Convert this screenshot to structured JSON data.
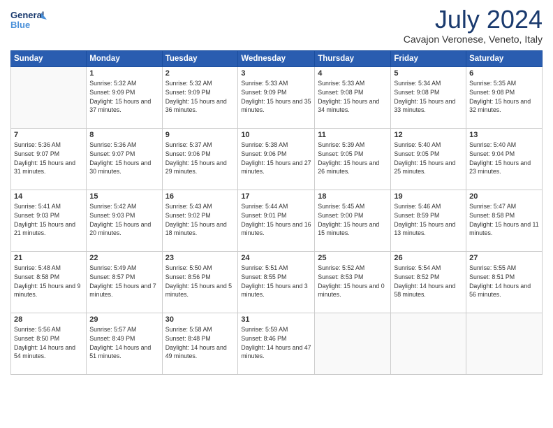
{
  "logo": {
    "line1": "General",
    "line2": "Blue"
  },
  "title": "July 2024",
  "location": "Cavajon Veronese, Veneto, Italy",
  "weekdays": [
    "Sunday",
    "Monday",
    "Tuesday",
    "Wednesday",
    "Thursday",
    "Friday",
    "Saturday"
  ],
  "weeks": [
    [
      {
        "day": "",
        "sunrise": "",
        "sunset": "",
        "daylight": ""
      },
      {
        "day": "1",
        "sunrise": "Sunrise: 5:32 AM",
        "sunset": "Sunset: 9:09 PM",
        "daylight": "Daylight: 15 hours and 37 minutes."
      },
      {
        "day": "2",
        "sunrise": "Sunrise: 5:32 AM",
        "sunset": "Sunset: 9:09 PM",
        "daylight": "Daylight: 15 hours and 36 minutes."
      },
      {
        "day": "3",
        "sunrise": "Sunrise: 5:33 AM",
        "sunset": "Sunset: 9:09 PM",
        "daylight": "Daylight: 15 hours and 35 minutes."
      },
      {
        "day": "4",
        "sunrise": "Sunrise: 5:33 AM",
        "sunset": "Sunset: 9:08 PM",
        "daylight": "Daylight: 15 hours and 34 minutes."
      },
      {
        "day": "5",
        "sunrise": "Sunrise: 5:34 AM",
        "sunset": "Sunset: 9:08 PM",
        "daylight": "Daylight: 15 hours and 33 minutes."
      },
      {
        "day": "6",
        "sunrise": "Sunrise: 5:35 AM",
        "sunset": "Sunset: 9:08 PM",
        "daylight": "Daylight: 15 hours and 32 minutes."
      }
    ],
    [
      {
        "day": "7",
        "sunrise": "Sunrise: 5:36 AM",
        "sunset": "Sunset: 9:07 PM",
        "daylight": "Daylight: 15 hours and 31 minutes."
      },
      {
        "day": "8",
        "sunrise": "Sunrise: 5:36 AM",
        "sunset": "Sunset: 9:07 PM",
        "daylight": "Daylight: 15 hours and 30 minutes."
      },
      {
        "day": "9",
        "sunrise": "Sunrise: 5:37 AM",
        "sunset": "Sunset: 9:06 PM",
        "daylight": "Daylight: 15 hours and 29 minutes."
      },
      {
        "day": "10",
        "sunrise": "Sunrise: 5:38 AM",
        "sunset": "Sunset: 9:06 PM",
        "daylight": "Daylight: 15 hours and 27 minutes."
      },
      {
        "day": "11",
        "sunrise": "Sunrise: 5:39 AM",
        "sunset": "Sunset: 9:05 PM",
        "daylight": "Daylight: 15 hours and 26 minutes."
      },
      {
        "day": "12",
        "sunrise": "Sunrise: 5:40 AM",
        "sunset": "Sunset: 9:05 PM",
        "daylight": "Daylight: 15 hours and 25 minutes."
      },
      {
        "day": "13",
        "sunrise": "Sunrise: 5:40 AM",
        "sunset": "Sunset: 9:04 PM",
        "daylight": "Daylight: 15 hours and 23 minutes."
      }
    ],
    [
      {
        "day": "14",
        "sunrise": "Sunrise: 5:41 AM",
        "sunset": "Sunset: 9:03 PM",
        "daylight": "Daylight: 15 hours and 21 minutes."
      },
      {
        "day": "15",
        "sunrise": "Sunrise: 5:42 AM",
        "sunset": "Sunset: 9:03 PM",
        "daylight": "Daylight: 15 hours and 20 minutes."
      },
      {
        "day": "16",
        "sunrise": "Sunrise: 5:43 AM",
        "sunset": "Sunset: 9:02 PM",
        "daylight": "Daylight: 15 hours and 18 minutes."
      },
      {
        "day": "17",
        "sunrise": "Sunrise: 5:44 AM",
        "sunset": "Sunset: 9:01 PM",
        "daylight": "Daylight: 15 hours and 16 minutes."
      },
      {
        "day": "18",
        "sunrise": "Sunrise: 5:45 AM",
        "sunset": "Sunset: 9:00 PM",
        "daylight": "Daylight: 15 hours and 15 minutes."
      },
      {
        "day": "19",
        "sunrise": "Sunrise: 5:46 AM",
        "sunset": "Sunset: 8:59 PM",
        "daylight": "Daylight: 15 hours and 13 minutes."
      },
      {
        "day": "20",
        "sunrise": "Sunrise: 5:47 AM",
        "sunset": "Sunset: 8:58 PM",
        "daylight": "Daylight: 15 hours and 11 minutes."
      }
    ],
    [
      {
        "day": "21",
        "sunrise": "Sunrise: 5:48 AM",
        "sunset": "Sunset: 8:58 PM",
        "daylight": "Daylight: 15 hours and 9 minutes."
      },
      {
        "day": "22",
        "sunrise": "Sunrise: 5:49 AM",
        "sunset": "Sunset: 8:57 PM",
        "daylight": "Daylight: 15 hours and 7 minutes."
      },
      {
        "day": "23",
        "sunrise": "Sunrise: 5:50 AM",
        "sunset": "Sunset: 8:56 PM",
        "daylight": "Daylight: 15 hours and 5 minutes."
      },
      {
        "day": "24",
        "sunrise": "Sunrise: 5:51 AM",
        "sunset": "Sunset: 8:55 PM",
        "daylight": "Daylight: 15 hours and 3 minutes."
      },
      {
        "day": "25",
        "sunrise": "Sunrise: 5:52 AM",
        "sunset": "Sunset: 8:53 PM",
        "daylight": "Daylight: 15 hours and 0 minutes."
      },
      {
        "day": "26",
        "sunrise": "Sunrise: 5:54 AM",
        "sunset": "Sunset: 8:52 PM",
        "daylight": "Daylight: 14 hours and 58 minutes."
      },
      {
        "day": "27",
        "sunrise": "Sunrise: 5:55 AM",
        "sunset": "Sunset: 8:51 PM",
        "daylight": "Daylight: 14 hours and 56 minutes."
      }
    ],
    [
      {
        "day": "28",
        "sunrise": "Sunrise: 5:56 AM",
        "sunset": "Sunset: 8:50 PM",
        "daylight": "Daylight: 14 hours and 54 minutes."
      },
      {
        "day": "29",
        "sunrise": "Sunrise: 5:57 AM",
        "sunset": "Sunset: 8:49 PM",
        "daylight": "Daylight: 14 hours and 51 minutes."
      },
      {
        "day": "30",
        "sunrise": "Sunrise: 5:58 AM",
        "sunset": "Sunset: 8:48 PM",
        "daylight": "Daylight: 14 hours and 49 minutes."
      },
      {
        "day": "31",
        "sunrise": "Sunrise: 5:59 AM",
        "sunset": "Sunset: 8:46 PM",
        "daylight": "Daylight: 14 hours and 47 minutes."
      },
      {
        "day": "",
        "sunrise": "",
        "sunset": "",
        "daylight": ""
      },
      {
        "day": "",
        "sunrise": "",
        "sunset": "",
        "daylight": ""
      },
      {
        "day": "",
        "sunrise": "",
        "sunset": "",
        "daylight": ""
      }
    ]
  ]
}
